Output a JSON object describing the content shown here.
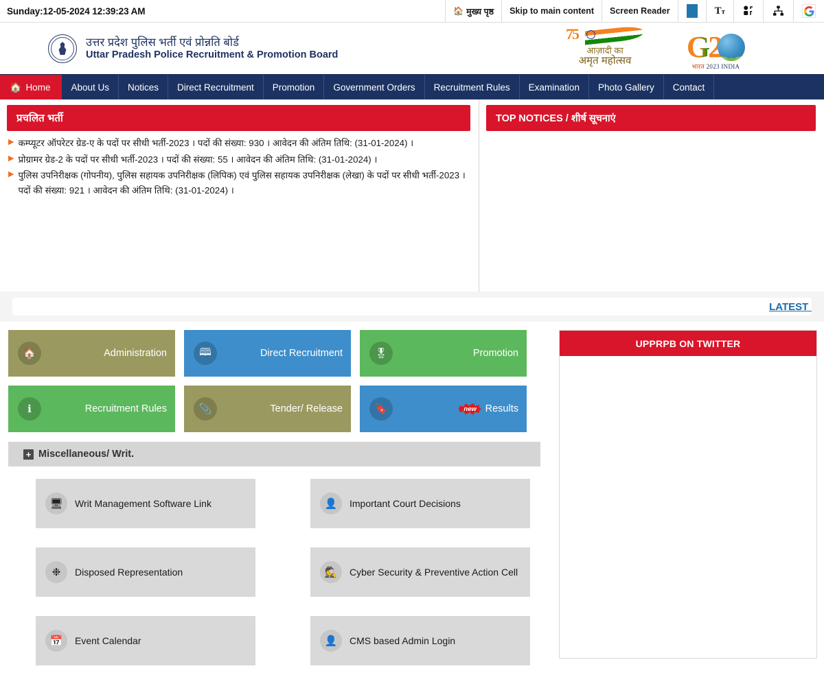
{
  "topbar": {
    "datetime": "Sunday:12-05-2024 12:39:23 AM",
    "items": [
      {
        "label": "मुख्य पृष्ठ",
        "icon": "home-icon"
      },
      {
        "label": "Skip to main content",
        "icon": ""
      },
      {
        "label": "Screen Reader",
        "icon": ""
      }
    ],
    "icons": [
      {
        "name": "theme-color-swatch",
        "glyph": ""
      },
      {
        "name": "font-size-icon",
        "glyph": "Tт"
      },
      {
        "name": "social-share-icon",
        "glyph": ""
      },
      {
        "name": "sitemap-icon",
        "glyph": ""
      },
      {
        "name": "google-translate-icon",
        "glyph": "G"
      }
    ]
  },
  "masthead": {
    "org_hindi": "उत्तर प्रदेश पुलिस भर्ती एवं प्रोन्नति बोर्ड",
    "org_english": "Uttar Pradesh Police Recruitment & Promotion Board",
    "emblem_name": "up-police-emblem",
    "azadi": {
      "line1": "आज़ादी का",
      "line2": "अमृत महोत्सव",
      "mark": "75"
    },
    "g20": {
      "g": "G",
      "two": "2",
      "sub_hi": "भारत",
      "sub_en": "2023 INDIA"
    }
  },
  "nav": {
    "items": [
      {
        "label": "Home",
        "icon": "home-icon",
        "active": true
      },
      {
        "label": "About Us",
        "active": false
      },
      {
        "label": "Notices",
        "active": false
      },
      {
        "label": "Direct Recruitment",
        "active": false
      },
      {
        "label": "Promotion",
        "active": false
      },
      {
        "label": "Government Orders",
        "active": false
      },
      {
        "label": "Recruitment Rules",
        "active": false
      },
      {
        "label": "Examination",
        "active": false
      },
      {
        "label": "Photo Gallery",
        "active": false
      },
      {
        "label": "Contact",
        "active": false
      }
    ]
  },
  "current_recruitment": {
    "heading": "प्रचलित भर्ती",
    "items": [
      "कम्प्यूटर ऑपरेटर ग्रेड-ए के पदों पर सीधी भर्ती-2023 । पदों की संख्या: 930 । आवेदन की अंतिम तिथि: (31-01-2024) ।",
      "प्रोग्रामर ग्रेड-2 के पदों पर सीधी भर्ती-2023 । पदों की संख्या: 55 । आवेदन की अंतिम तिथि: (31-01-2024) ।",
      "पुलिस उपनिरीक्षक (गोपनीय), पुलिस सहायक उपनिरीक्षक (लिपिक) एवं पुलिस सहायक उपनिरीक्षक (लेखा) के पदों पर सीधी भर्ती-2023 । पदों की संख्या: 921 । आवेदन की अंतिम तिथि: (31-01-2024) ।"
    ]
  },
  "top_notices": {
    "heading": "TOP NOTICES / शीर्ष सूचनाएं",
    "items": []
  },
  "marquee": {
    "text": "LATEST NO"
  },
  "tiles": [
    {
      "label": "Administration",
      "icon": "home-icon",
      "color": "#9a9a60",
      "badge": true
    },
    {
      "label": "Direct Recruitment",
      "icon": "contact-book-icon",
      "color": "#3d8ecb",
      "badge": false
    },
    {
      "label": "Promotion",
      "icon": "medal-icon",
      "color": "#5cb85c",
      "badge": false
    },
    {
      "label": "Recruitment Rules",
      "icon": "info-person-icon",
      "color": "#5cb85c",
      "badge": false
    },
    {
      "label": "Tender/ Release",
      "icon": "paperclip-icon",
      "color": "#9a9a60",
      "badge": false
    },
    {
      "label": "Results",
      "icon": "bookmark-icon",
      "color": "#3d8ecb",
      "badge": true,
      "badge_text": "new"
    }
  ],
  "miscellaneous": {
    "heading": "Miscellaneous/ Writ.",
    "expander": "+",
    "items": [
      {
        "label": "Writ Management Software Link",
        "icon": "server-icon"
      },
      {
        "label": "Important Court Decisions",
        "icon": "judge-person-icon"
      },
      {
        "label": "Disposed Representation",
        "icon": "gear-burst-icon"
      },
      {
        "label": "Cyber Security & Preventive Action Cell",
        "icon": "spy-icon"
      },
      {
        "label": "Event Calendar",
        "icon": "calendar-icon"
      },
      {
        "label": "CMS based Admin Login",
        "icon": "user-lock-icon"
      }
    ]
  },
  "twitter": {
    "heading": "UPPRPB ON TWITTER"
  },
  "colors": {
    "nav_bg": "#1c3262",
    "accent_red": "#d8152a",
    "brand_blue": "#1f3260",
    "tile_khaki": "#9a9a60",
    "tile_blue": "#3d8ecb",
    "tile_green": "#5cb85c",
    "link_blue": "#1b6ca8"
  }
}
